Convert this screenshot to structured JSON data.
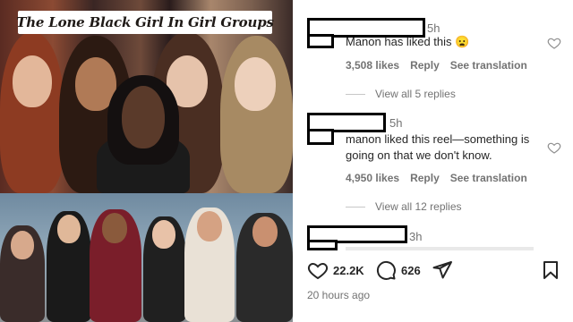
{
  "reel": {
    "title": "The Lone Black Girl In Girl Groups"
  },
  "comments": [
    {
      "time": "5h",
      "text": "Manon has liked this 😦",
      "likes": "3,508 likes",
      "reply_label": "Reply",
      "translate_label": "See translation",
      "view_replies": "View all 5 replies"
    },
    {
      "time": "5h",
      "text": "manon liked this reel—something is going on that we don't know.",
      "likes": "4,950 likes",
      "reply_label": "Reply",
      "translate_label": "See translation",
      "view_replies": "View all 12 replies"
    },
    {
      "time": "3h",
      "text": ""
    }
  ],
  "actions": {
    "like_count": "22.2K",
    "comment_count": "626"
  },
  "post_time": "20 hours ago",
  "colors": {
    "text": "#262626",
    "secondary": "#737373"
  }
}
